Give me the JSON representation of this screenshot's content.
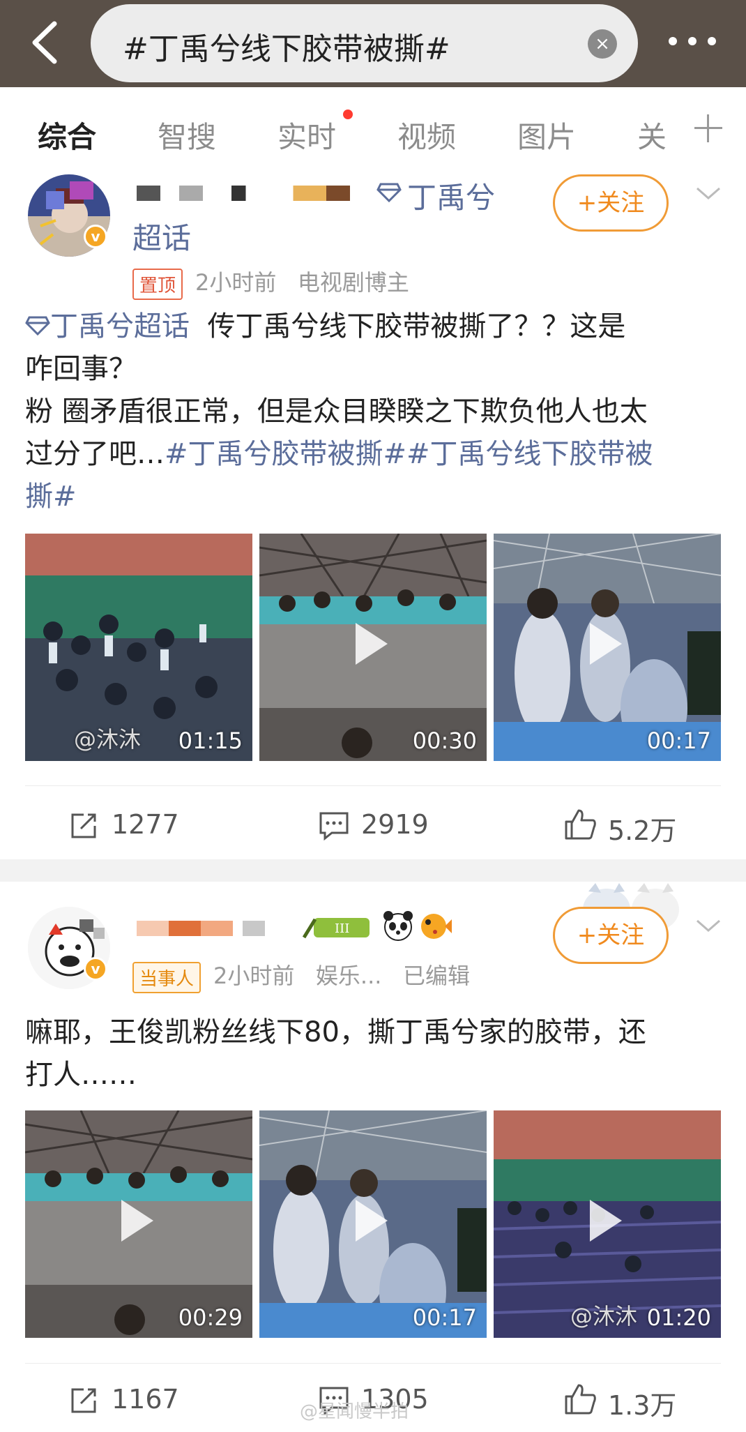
{
  "search": {
    "query": "#丁禹兮线下胶带被撕#",
    "clear_glyph": "×"
  },
  "tabs": [
    {
      "label": "综合",
      "active": true
    },
    {
      "label": "智搜"
    },
    {
      "label": "实时",
      "has_dot": true
    },
    {
      "label": "视频"
    },
    {
      "label": "图片"
    },
    {
      "label": "关"
    }
  ],
  "posts": [
    {
      "topic_badge": "丁禹兮",
      "topic_badge_line2": "超话",
      "follow_label": "+关注",
      "tag": "置顶",
      "time": "2小时前",
      "source": "电视剧博主",
      "text_topic": "丁禹兮超话",
      "text_line1": "传丁禹兮线下胶带被撕了？？这是",
      "text_line2": "咋回事？",
      "text_line3": "粉 圈矛盾很正常，但是众目睽睽之下欺负他人也太",
      "text_line4_prefix": "过分了吧…",
      "text_line4_link": "#丁禹兮胶带被撕##丁禹兮线下胶带被",
      "text_line5_link": "撕#",
      "videos": [
        {
          "duration": "01:15",
          "overlay": "@沐沐"
        },
        {
          "duration": "00:30"
        },
        {
          "duration": "00:17"
        }
      ],
      "reposts": "1277",
      "comments": "2919",
      "likes": "5.2万"
    },
    {
      "follow_label": "+关注",
      "tag": "当事人",
      "time": "2小时前",
      "source": "娱乐...",
      "edited": "已编辑",
      "level_badge": "III",
      "text_line1": "嘛耶，王俊凯粉丝线下80，撕丁禹兮家的胶带，还",
      "text_line2": "打人……",
      "videos": [
        {
          "duration": "00:29"
        },
        {
          "duration": "00:17"
        },
        {
          "duration": "01:20",
          "overlay": "@沐沐"
        }
      ],
      "reposts": "1167",
      "comments": "1305",
      "likes": "1.3万"
    }
  ],
  "watermark": "@星闻慢半拍",
  "colors": {
    "header_bg": "#5a5048",
    "link": "#5b6d9a",
    "follow": "#f08a1e",
    "tab_dot": "#ff3b30"
  }
}
